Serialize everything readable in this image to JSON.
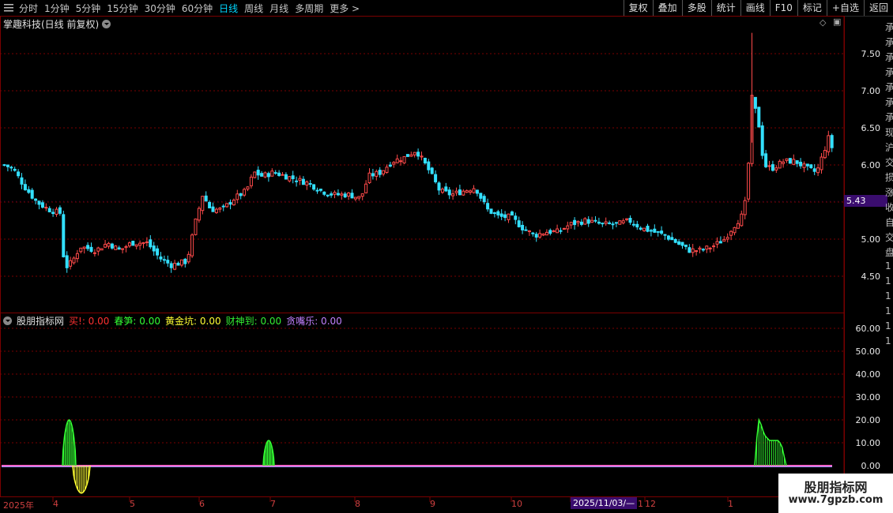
{
  "toolbar": {
    "tabs": [
      "分时",
      "1分钟",
      "5分钟",
      "15分钟",
      "30分钟",
      "60分钟",
      "日线",
      "周线",
      "月线",
      "多周期",
      "更多 >"
    ],
    "active_tab": "日线",
    "actions": [
      "复权",
      "叠加",
      "多股",
      "统计",
      "画线",
      "F10",
      "标记",
      "+自选",
      "返回"
    ]
  },
  "stock": {
    "title": "掌趣科技(日线 前复权)",
    "current_price_label": "5.43"
  },
  "price_axis": [
    "7.50",
    "7.00",
    "6.50",
    "6.00",
    "5.00",
    "4.50"
  ],
  "indicator": {
    "name": "股朋指标网",
    "lines": [
      {
        "label": "买!",
        "value": ": 0.00",
        "color": "#ff3030"
      },
      {
        "label": "春笋",
        "value": ": 0.00",
        "color": "#33ff33"
      },
      {
        "label": "黄金坑",
        "value": ": 0.00",
        "color": "#ffff33"
      },
      {
        "label": "财神到",
        "value": ": 0.00",
        "color": "#33ee33"
      },
      {
        "label": "贪嘴乐",
        "value": ": 0.00",
        "color": "#c080ff"
      }
    ],
    "axis": [
      "60.00",
      "50.00",
      "40.00",
      "30.00",
      "20.00",
      "10.00",
      "0.00"
    ]
  },
  "date_axis": {
    "labels": [
      "2025年",
      "4",
      "5",
      "6",
      "7",
      "8",
      "9",
      "10",
      "11",
      "12",
      "1"
    ],
    "cursor_label": "2025/11/03/—"
  },
  "watermark": {
    "line1": "股朋指标网",
    "line2": "www.7gpzb.com"
  },
  "right_strip_chars": [
    "承",
    "承",
    "承",
    "承",
    "承",
    "承",
    "承",
    "现",
    "沪",
    "交",
    "损",
    "涨",
    "收",
    "自",
    "交",
    "盘",
    "1",
    "1",
    "1",
    "1",
    "1",
    "1"
  ],
  "colors": {
    "up": "#ff4a4a",
    "down": "#33e0ff",
    "grid": "#7a0000",
    "accent": "#00d7ff"
  }
}
